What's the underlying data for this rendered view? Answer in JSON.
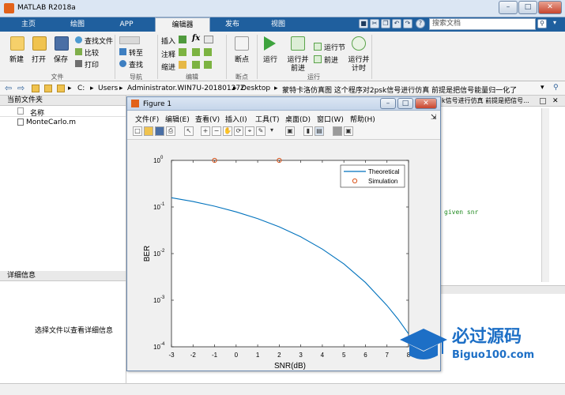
{
  "window": {
    "title": "MATLAB R2018a"
  },
  "tabs": [
    "主页",
    "绘图",
    "APP",
    "编辑器",
    "发布",
    "视图"
  ],
  "active_tab": "编辑器",
  "search": {
    "placeholder": "搜索文档"
  },
  "ribbon": {
    "file_group": {
      "label": "文件",
      "new": "新建",
      "open": "打开",
      "save": "保存",
      "find_file": "查找文件",
      "compare": "比较",
      "print": "打印"
    },
    "nav_group": {
      "label": "导航",
      "goto": "转至",
      "find": "查找"
    },
    "edit_group": {
      "label": "编辑",
      "insert": "插入",
      "comment": "注释",
      "indent": "缩进",
      "fx": "fx"
    },
    "breakpoint_group": {
      "label": "断点",
      "breakpoints": "断点"
    },
    "run_group": {
      "label": "运行",
      "run": "运行",
      "run_advance_1": "运行并",
      "run_advance_2": "前进",
      "run_section": "运行节",
      "advance": "前进",
      "run_time_1": "运行并",
      "run_time_2": "计时"
    }
  },
  "address": {
    "crumbs": [
      "C:",
      "Users",
      "Administrator.WIN7U-20180127Z",
      "Desktop",
      "蒙特卡洛仿真图 这个程序对2psk信号进行仿真 前提是把信号能量归一化了"
    ]
  },
  "current_folder": {
    "title": "当前文件夹",
    "column": "名称",
    "files": [
      "MonteCarlo.m"
    ]
  },
  "details": {
    "title": "详细信息",
    "hint": "选择文件以查看详细信息"
  },
  "editor_bg": {
    "tab_text": "k信号进行仿真 前提是把信号...",
    "code_text": "given snr"
  },
  "figure": {
    "title": "Figure 1",
    "menus": [
      "文件(F)",
      "编辑(E)",
      "查看(V)",
      "插入(I)",
      "工具(T)",
      "桌面(D)",
      "窗口(W)",
      "帮助(H)"
    ]
  },
  "chart_data": {
    "type": "line",
    "xlabel": "SNR(dB)",
    "ylabel": "BER",
    "xlim": [
      -3,
      8
    ],
    "ylim": [
      0.0001,
      1
    ],
    "yscale": "log",
    "xticks": [
      -3,
      -2,
      -1,
      0,
      1,
      2,
      3,
      4,
      5,
      6,
      7,
      8
    ],
    "yticks": [
      "10^0",
      "10^-1",
      "10^-2",
      "10^-3",
      "10^-4"
    ],
    "legend": "top-right",
    "series": [
      {
        "name": "Theoretical",
        "color": "#0072bd",
        "style": "line",
        "x": [
          -3,
          -2,
          -1,
          0,
          1,
          2,
          3,
          4,
          5,
          6,
          7,
          7.5,
          8
        ],
        "y": [
          0.158,
          0.131,
          0.104,
          0.0786,
          0.0563,
          0.0375,
          0.0229,
          0.0125,
          0.006,
          0.0024,
          0.00077,
          0.0004,
          0.00019
        ]
      },
      {
        "name": "Simulation",
        "color": "#d95319",
        "style": "marker",
        "x": [
          -1,
          2
        ],
        "y": [
          1,
          1
        ]
      }
    ]
  },
  "watermark": {
    "title": "必过源码",
    "url": "Biguo100.com"
  }
}
